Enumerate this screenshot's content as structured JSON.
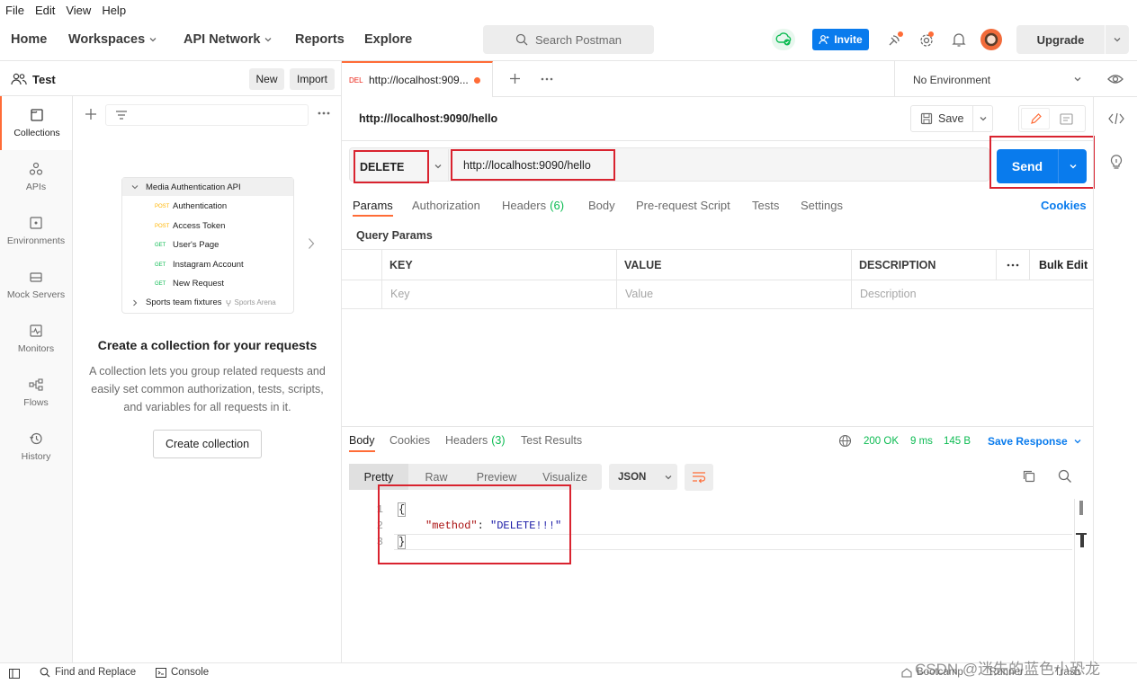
{
  "menu": [
    "File",
    "Edit",
    "View",
    "Help"
  ],
  "nav": {
    "home": "Home",
    "workspaces": "Workspaces",
    "api_network": "API Network",
    "reports": "Reports",
    "explore": "Explore"
  },
  "search": {
    "placeholder": "Search Postman"
  },
  "header": {
    "invite": "Invite",
    "upgrade": "Upgrade"
  },
  "workspace": {
    "name": "Test",
    "new": "New",
    "import": "Import"
  },
  "sidebar": {
    "items": [
      {
        "label": "Collections",
        "icon": "collections-icon"
      },
      {
        "label": "APIs",
        "icon": "apis-icon"
      },
      {
        "label": "Environments",
        "icon": "environments-icon"
      },
      {
        "label": "Mock Servers",
        "icon": "mock-servers-icon"
      },
      {
        "label": "Monitors",
        "icon": "monitors-icon"
      },
      {
        "label": "Flows",
        "icon": "flows-icon"
      },
      {
        "label": "History",
        "icon": "history-icon"
      }
    ]
  },
  "illustration": {
    "folder": "Media Authentication API",
    "items": [
      {
        "method": "POST",
        "name": "Authentication"
      },
      {
        "method": "POST",
        "name": "Access Token"
      },
      {
        "method": "GET",
        "name": "User's Page"
      },
      {
        "method": "GET",
        "name": "Instagram Account"
      },
      {
        "method": "GET",
        "name": "New Request"
      }
    ],
    "folder2": "Sports team fixtures",
    "folder2_tag": "Sports Arena"
  },
  "empty_state": {
    "title": "Create a collection for your requests",
    "desc": "A collection lets you group related requests and easily set common authorization, tests, scripts, and variables for all requests in it.",
    "button": "Create collection"
  },
  "tab": {
    "method": "DEL",
    "title": "http://localhost:909...",
    "environment": "No Environment"
  },
  "request": {
    "name": "http://localhost:9090/hello",
    "save": "Save",
    "method": "DELETE",
    "url": "http://localhost:9090/hello",
    "send": "Send",
    "tabs": [
      "Params",
      "Authorization",
      "Headers",
      "Body",
      "Pre-request Script",
      "Tests",
      "Settings"
    ],
    "headers_count": "(6)",
    "cookies": "Cookies",
    "query_params": "Query Params",
    "columns": {
      "key": "KEY",
      "value": "VALUE",
      "description": "DESCRIPTION",
      "bulk_edit": "Bulk Edit"
    },
    "placeholders": {
      "key": "Key",
      "value": "Value",
      "description": "Description"
    }
  },
  "response": {
    "tabs": [
      "Body",
      "Cookies",
      "Headers",
      "Test Results"
    ],
    "headers_count": "(3)",
    "status": "200 OK",
    "time": "9 ms",
    "size": "145 B",
    "save_response": "Save Response",
    "view_tabs": [
      "Pretty",
      "Raw",
      "Preview",
      "Visualize"
    ],
    "format": "JSON",
    "lines": [
      "1",
      "2",
      "3"
    ],
    "code_open": "{",
    "code_key": "\"method\"",
    "code_colon": ":",
    "code_value": "\"DELETE!!!\"",
    "code_close": "}"
  },
  "footer": {
    "find_replace": "Find and Replace",
    "console": "Console",
    "bootcamp": "Bootcamp",
    "runner": "Runner",
    "trash": "Trash"
  },
  "watermark": "CSDN @迷失的蓝色小恐龙",
  "colors": {
    "accent": "#ff6c37",
    "primary": "#097bed",
    "highlight": "#d9232f",
    "success": "#0cbb52"
  }
}
